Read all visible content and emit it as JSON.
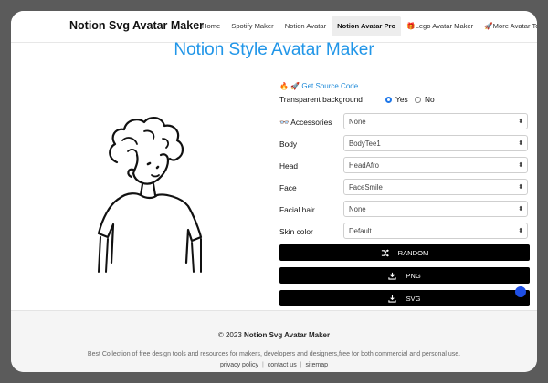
{
  "header": {
    "brand": "Notion Svg Avatar Maker",
    "nav": [
      "Home",
      "Spotify Maker",
      "Notion Avatar",
      "Notion Avatar Pro",
      "🎁Lego Avatar Maker",
      "🚀More Avatar Tools"
    ],
    "active_index": 3
  },
  "main": {
    "title": "Notion Style Avatar Maker",
    "source_link": "🔥 🚀 Get Source Code",
    "transparent": {
      "label": "Transparent background",
      "yes": "Yes",
      "no": "No",
      "selected": "Yes"
    },
    "selects": [
      {
        "label": "👓 Accessories",
        "value": "None"
      },
      {
        "label": "Body",
        "value": "BodyTee1"
      },
      {
        "label": "Head",
        "value": "HeadAfro"
      },
      {
        "label": "Face",
        "value": "FaceSmile"
      },
      {
        "label": "Facial hair",
        "value": "None"
      },
      {
        "label": "Skin color",
        "value": "Default"
      }
    ],
    "buttons": {
      "random": "RANDOM",
      "png": "PNG",
      "svg": "SVG"
    }
  },
  "footer": {
    "copyright": "© 2023",
    "brand": "Notion Svg Avatar Maker",
    "tagline": "Best Collection of free design tools and resources for makers, developers and designers,free for both commercial and personal use.",
    "links": [
      "privacy policy",
      "contact us",
      "sitemap"
    ]
  },
  "colors": {
    "accent": "#2196e8",
    "radio": "#1e77e9",
    "dot": "#1e4fe6"
  }
}
